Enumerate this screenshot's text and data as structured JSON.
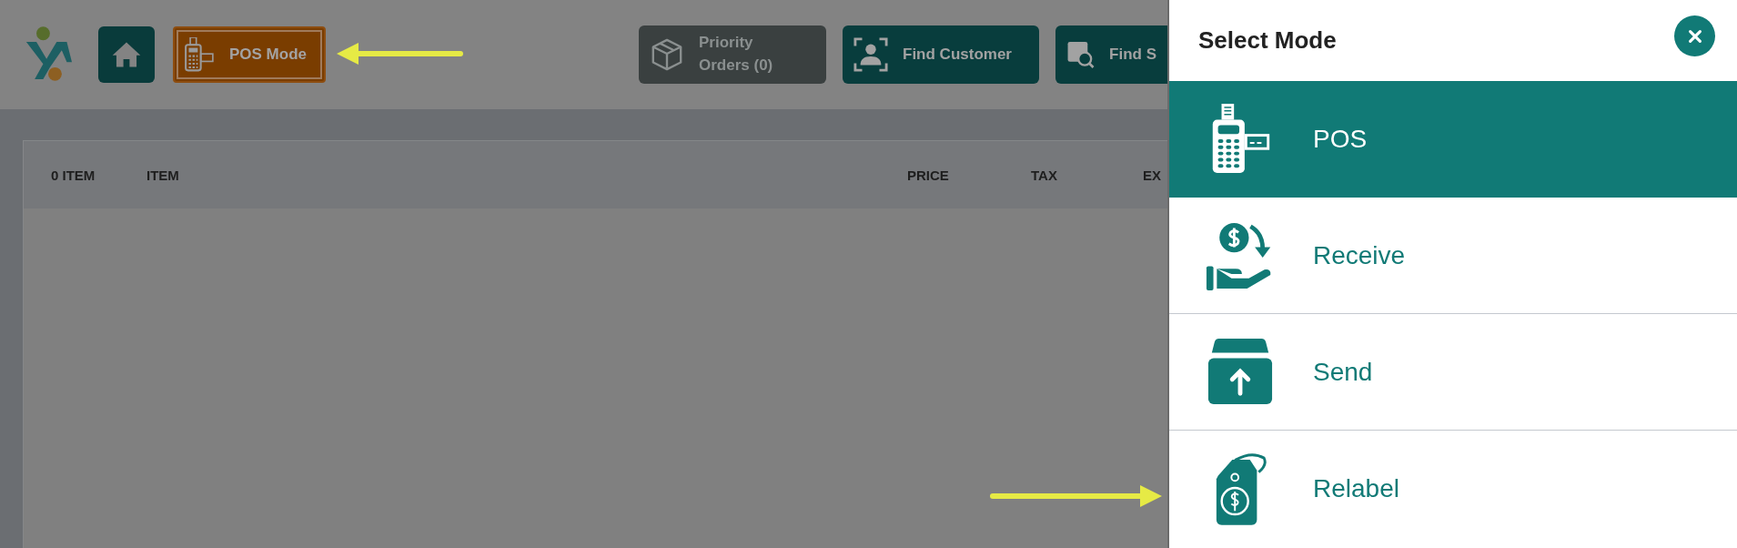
{
  "header": {
    "mode_button": {
      "label": "POS Mode"
    },
    "actions": [
      {
        "label": "Priority Orders (0)",
        "disabled": true
      },
      {
        "label": "Find Customer",
        "disabled": false
      },
      {
        "label": "Find S",
        "disabled": false
      }
    ]
  },
  "table": {
    "columns": [
      "0 ITEM",
      "ITEM",
      "PRICE",
      "TAX",
      "EX"
    ]
  },
  "mode_panel": {
    "title": "Select Mode",
    "modes": [
      {
        "label": "POS",
        "selected": true
      },
      {
        "label": "Receive",
        "selected": false
      },
      {
        "label": "Send",
        "selected": false
      },
      {
        "label": "Relabel",
        "selected": false
      }
    ]
  }
}
